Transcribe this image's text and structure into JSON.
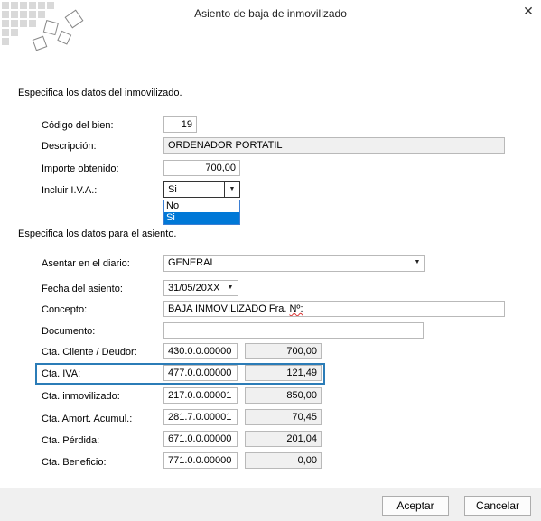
{
  "window": {
    "title": "Asiento de baja de inmovilizado"
  },
  "section1": {
    "heading": "Especifica  los datos del inmovilizado.",
    "codigo_label": "Código del bien:",
    "codigo_value": "19",
    "descripcion_label": "Descripción:",
    "descripcion_value": "ORDENADOR PORTATIL",
    "importe_label": "Importe obtenido:",
    "importe_value": "700,00",
    "iva_label": "Incluir I.V.A.:",
    "iva_selected": "Si",
    "iva_options": [
      "No",
      "Si"
    ]
  },
  "section2": {
    "heading": "Especifica los datos para el asiento.",
    "diario_label": "Asentar en el diario:",
    "diario_value": "GENERAL",
    "fecha_label": "Fecha del asiento:",
    "fecha_value": "31/05/20XX",
    "concepto_label": "Concepto:",
    "concepto_value_prefix": "BAJA INMOVILIZADO Fra. ",
    "concepto_value_suffix": "Nº:",
    "documento_label": "Documento:",
    "documento_value": "",
    "cuentas": [
      {
        "label": "Cta. Cliente / Deudor:",
        "cuenta": "430.0.0.00000",
        "importe": "700,00"
      },
      {
        "label": "Cta. IVA:",
        "cuenta": "477.0.0.00000",
        "importe": "121,49"
      },
      {
        "label": "Cta. inmovilizado:",
        "cuenta": "217.0.0.00001",
        "importe": "850,00"
      },
      {
        "label": "Cta. Amort. Acumul.:",
        "cuenta": "281.7.0.00001",
        "importe": "70,45"
      },
      {
        "label": "Cta. Pérdida:",
        "cuenta": "671.0.0.00000",
        "importe": "201,04"
      },
      {
        "label": "Cta. Beneficio:",
        "cuenta": "771.0.0.00000",
        "importe": "0,00"
      }
    ]
  },
  "footer": {
    "accept_label": "Aceptar",
    "cancel_label": "Cancelar"
  },
  "colors": {
    "highlight": "#2b7cb7",
    "selection": "#0078d7",
    "footer_bg": "#f0f0f0"
  }
}
